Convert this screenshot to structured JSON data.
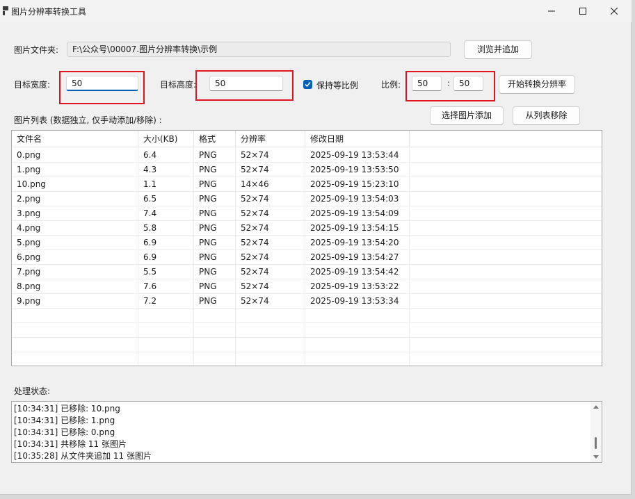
{
  "window": {
    "title": "图片分辨率转换工具"
  },
  "folder": {
    "label": "图片文件夹:",
    "path": "F:\\公众号\\00007.图片分辨率转换\\示例",
    "browse_label": "浏览并追加"
  },
  "size": {
    "width_label": "目标宽度:",
    "width_value": "50",
    "height_label": "目标高度:",
    "height_value": "50",
    "keep_ratio_label": "保持等比例",
    "keep_ratio_checked": true,
    "ratio_label": "比例:",
    "ratio_a": "50",
    "ratio_sep": ":",
    "ratio_b": "50",
    "start_label": "开始转换分辨率"
  },
  "list": {
    "label": "图片列表 (数据独立, 仅手动添加/移除) :",
    "add_label": "选择图片添加",
    "remove_label": "从列表移除",
    "columns": [
      "文件名",
      "大小(KB)",
      "格式",
      "分辨率",
      "修改日期"
    ],
    "rows": [
      [
        "0.png",
        "6.4",
        "PNG",
        "52×74",
        "2025-09-19 13:53:44"
      ],
      [
        "1.png",
        "4.3",
        "PNG",
        "52×74",
        "2025-09-19 13:53:50"
      ],
      [
        "10.png",
        "1.1",
        "PNG",
        "14×46",
        "2025-09-19 15:23:10"
      ],
      [
        "2.png",
        "6.5",
        "PNG",
        "52×74",
        "2025-09-19 13:54:03"
      ],
      [
        "3.png",
        "7.4",
        "PNG",
        "52×74",
        "2025-09-19 13:54:09"
      ],
      [
        "4.png",
        "5.8",
        "PNG",
        "52×74",
        "2025-09-19 13:54:15"
      ],
      [
        "5.png",
        "6.9",
        "PNG",
        "52×74",
        "2025-09-19 13:54:20"
      ],
      [
        "6.png",
        "6.9",
        "PNG",
        "52×74",
        "2025-09-19 13:54:27"
      ],
      [
        "7.png",
        "5.5",
        "PNG",
        "52×74",
        "2025-09-19 13:54:42"
      ],
      [
        "8.png",
        "7.6",
        "PNG",
        "52×74",
        "2025-09-19 13:53:22"
      ],
      [
        "9.png",
        "7.2",
        "PNG",
        "52×74",
        "2025-09-19 13:53:34"
      ],
      [
        "",
        "",
        "",
        "",
        ""
      ],
      [
        "",
        "",
        "",
        "",
        ""
      ],
      [
        "",
        "",
        "",
        "",
        ""
      ],
      [
        "",
        "",
        "",
        "",
        ""
      ]
    ]
  },
  "status": {
    "label": "处理状态:",
    "lines": [
      "[10:34:31] 已移除: 10.png",
      "[10:34:31] 已移除: 1.png",
      "[10:34:31] 已移除: 0.png",
      "[10:34:31] 共移除 11 张图片",
      "[10:35:28] 从文件夹追加 11 张图片"
    ]
  },
  "colors": {
    "accent": "#005fb8",
    "highlight": "#e0141e"
  }
}
